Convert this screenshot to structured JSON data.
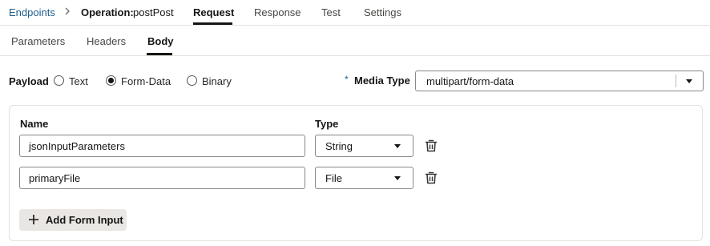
{
  "header": {
    "breadcrumb_link": "Endpoints",
    "operation_label": "Operation:",
    "operation_value": "postPost",
    "tabs": [
      {
        "label": "Request",
        "active": true
      },
      {
        "label": "Response",
        "active": false
      },
      {
        "label": "Test",
        "active": false
      },
      {
        "label": "Settings",
        "active": false
      }
    ]
  },
  "subtabs": [
    {
      "label": "Parameters",
      "active": false
    },
    {
      "label": "Headers",
      "active": false
    },
    {
      "label": "Body",
      "active": true
    }
  ],
  "payload": {
    "label": "Payload",
    "options": [
      {
        "label": "Text",
        "selected": false
      },
      {
        "label": "Form-Data",
        "selected": true
      },
      {
        "label": "Binary",
        "selected": false
      }
    ]
  },
  "media_type": {
    "required_marker": "*",
    "label": "Media Type",
    "value": "multipart/form-data"
  },
  "form": {
    "name_header": "Name",
    "type_header": "Type",
    "rows": [
      {
        "name": "jsonInputParameters",
        "type": "String"
      },
      {
        "name": "primaryFile",
        "type": "File"
      }
    ],
    "add_button_label": "Add Form Input"
  },
  "icons": {
    "breadcrumb_separator": "chevron-right-icon",
    "row_delete": "trash-icon",
    "add": "plus-icon",
    "dropdown": "caret-down-icon"
  },
  "colors": {
    "link": "#1f5e8c",
    "text": "#161513",
    "border": "#e4e1dd",
    "button_bg": "#e9e6e3"
  }
}
